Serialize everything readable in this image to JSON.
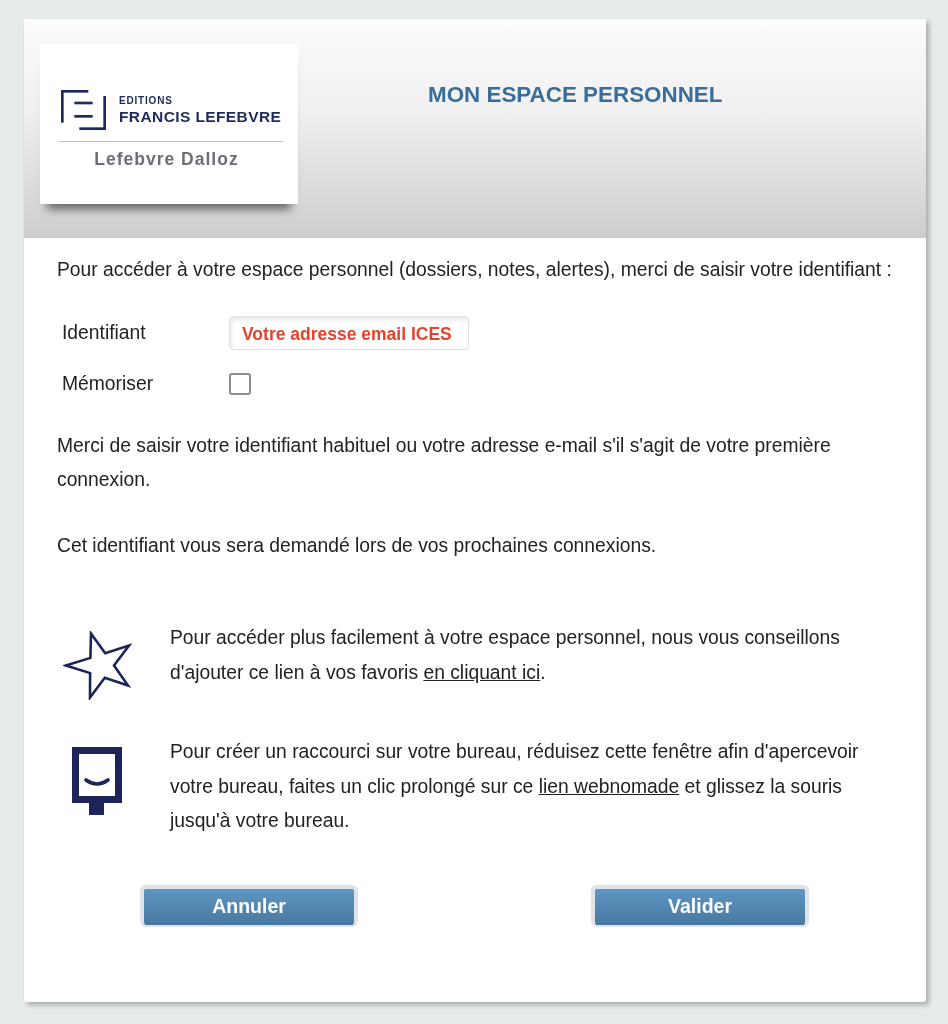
{
  "header": {
    "logo": {
      "label": "EDITIONS",
      "name": "FRANCIS LEFEBVRE",
      "subtitle": "Lefebvre Dalloz"
    },
    "title": "MON ESPACE PERSONNEL"
  },
  "intro": "Pour accéder à votre espace personnel (dossiers, notes, alertes), merci de saisir votre identifiant :",
  "form": {
    "fields": [
      {
        "kind": "text",
        "label": "Identifiant",
        "placeholder": "Votre adresse email ICES"
      },
      {
        "kind": "checkbox",
        "label": "Mémoriser",
        "checked": false
      }
    ]
  },
  "notes": [
    "Merci de saisir votre identifiant habituel ou votre adresse e-mail s'il s'agit de votre première connexion.",
    "Cet identifiant vous sera demandé lors de vos prochaines connexions."
  ],
  "tips": [
    {
      "kind": "star",
      "text_before": "Pour accéder plus facilement à votre espace personnel, nous vous conseillons d'ajouter ce lien à vos favoris ",
      "link": "en cliquant ici",
      "text_after": "."
    },
    {
      "kind": "screen",
      "text_before": "Pour créer un raccourci sur votre bureau, réduisez cette fenêtre afin d'apercevoir votre bureau, faites un clic prolongé sur ce ",
      "link": "lien webnomade",
      "text_after": " et glissez la souris jusqu'à votre bureau."
    }
  ],
  "buttons": [
    "Annuler",
    "Valider"
  ]
}
